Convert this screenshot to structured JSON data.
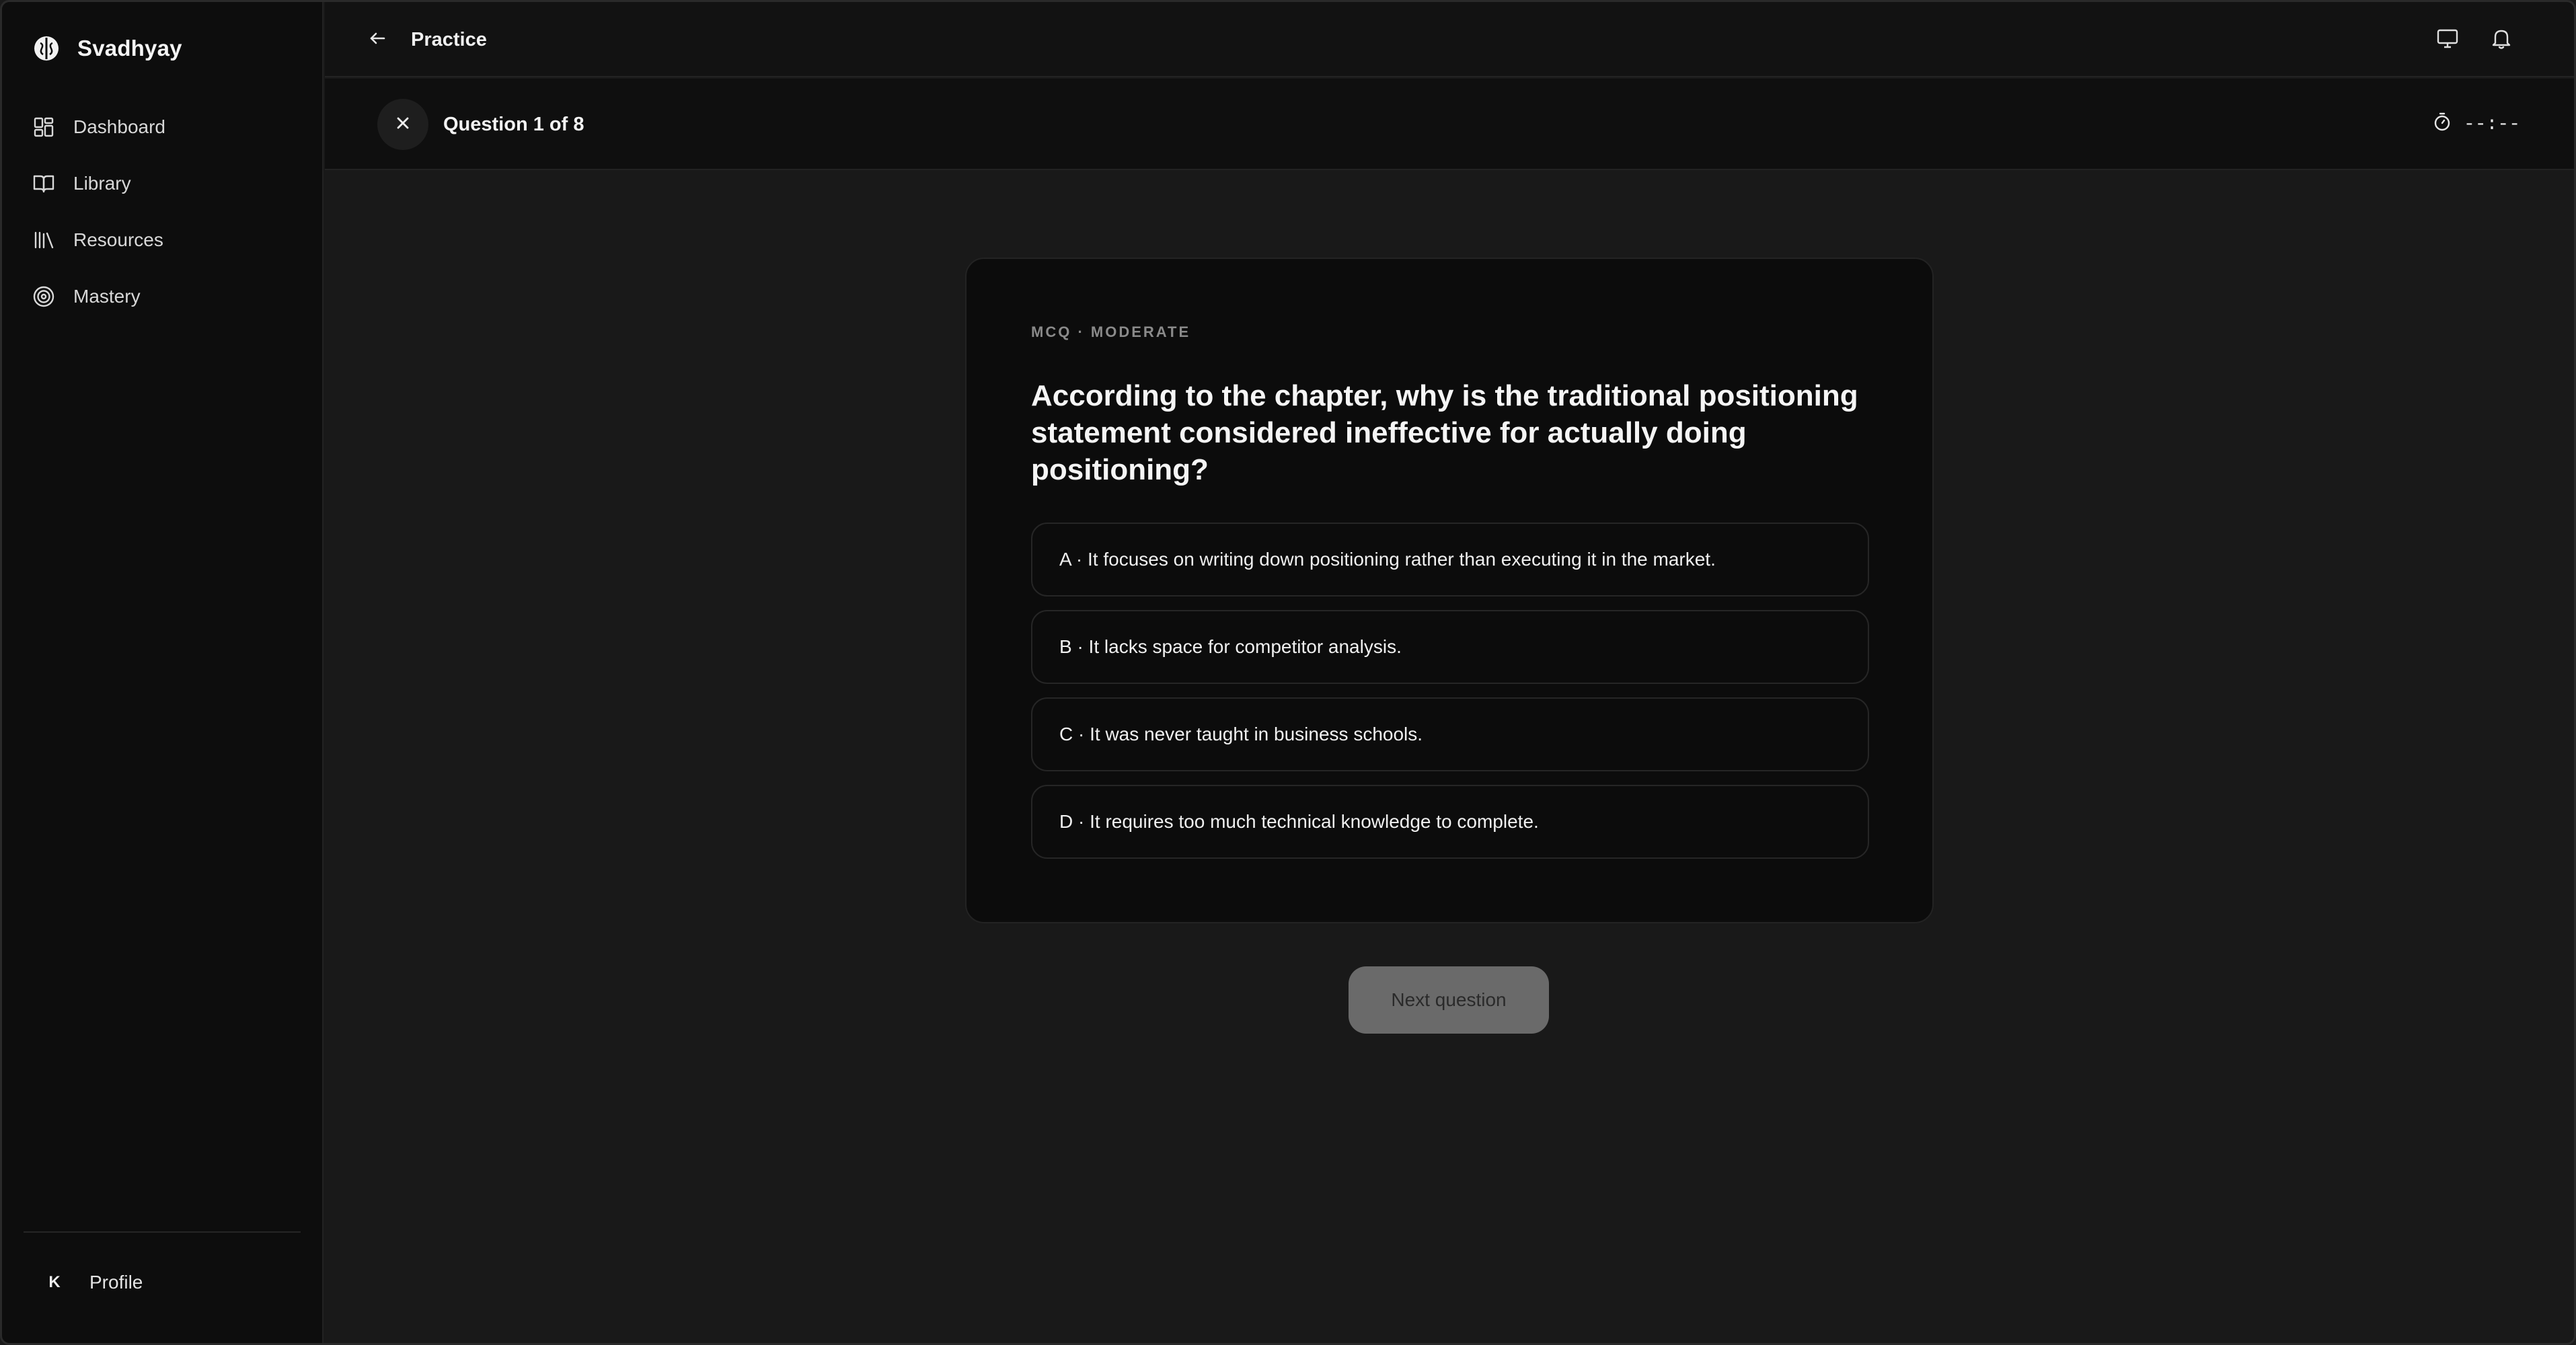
{
  "app": {
    "name": "Svadhyay"
  },
  "sidebar": {
    "items": [
      {
        "label": "Dashboard",
        "icon": "dashboard-grid-icon"
      },
      {
        "label": "Library",
        "icon": "open-book-icon"
      },
      {
        "label": "Resources",
        "icon": "books-shelf-icon"
      },
      {
        "label": "Mastery",
        "icon": "target-icon"
      }
    ],
    "profile": {
      "initial": "K",
      "label": "Profile"
    }
  },
  "header": {
    "title": "Practice",
    "icons": [
      "monitor-icon",
      "bell-icon"
    ]
  },
  "subheader": {
    "question_count": "Question 1 of 8",
    "timer": "--:--"
  },
  "question": {
    "meta": "MCQ · MODERATE",
    "text": "According to the chapter, why is the traditional positioning statement considered ineffective for actually doing positioning?",
    "options": [
      "A · It focuses on writing down positioning rather than executing it in the market.",
      "B · It lacks space for competitor analysis.",
      "C · It was never taught in business schools.",
      "D · It requires too much technical knowledge to complete."
    ]
  },
  "actions": {
    "next_label": "Next question"
  }
}
